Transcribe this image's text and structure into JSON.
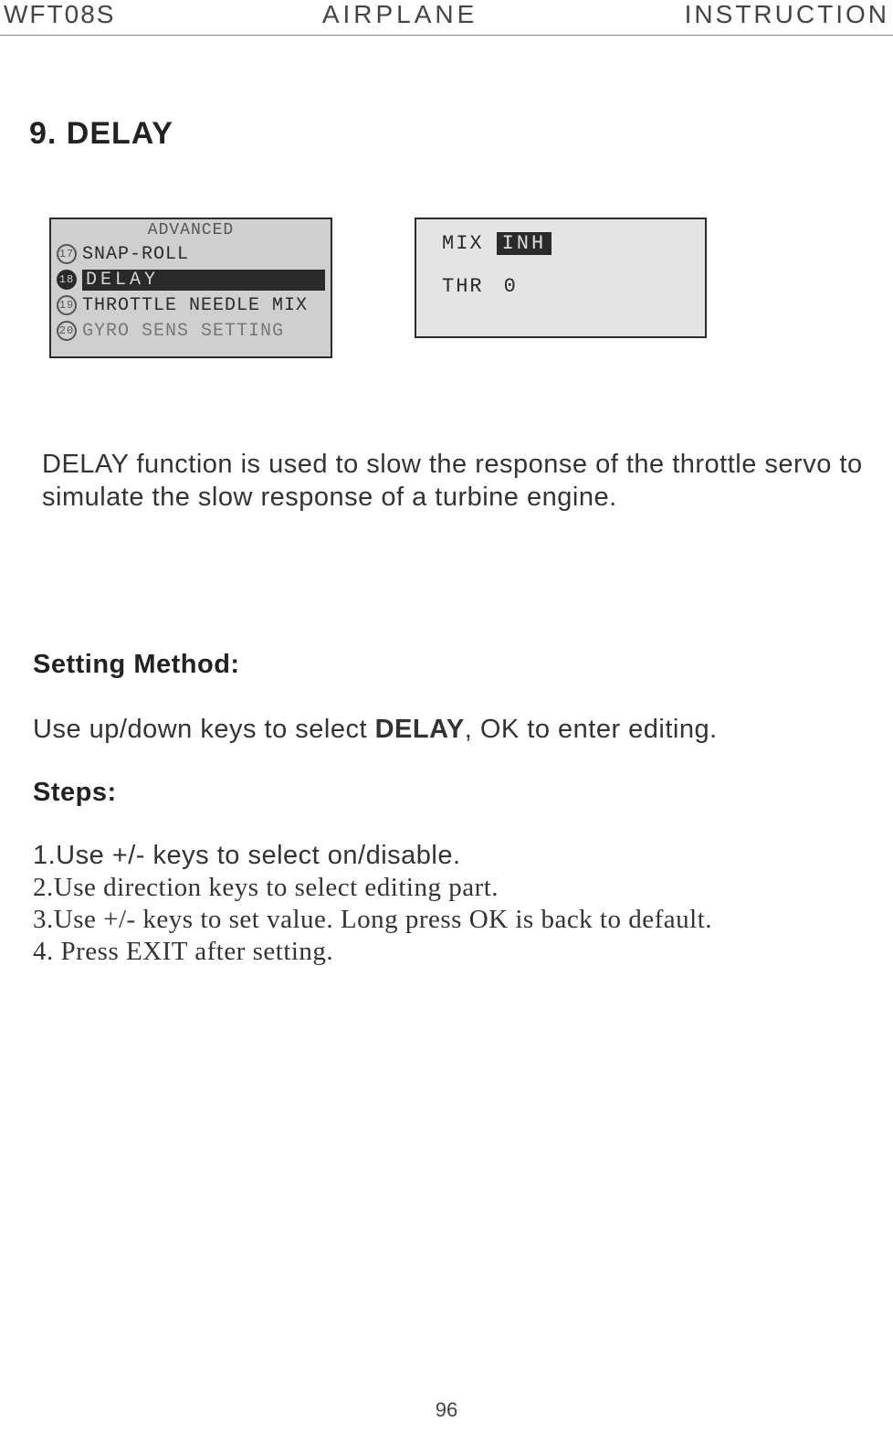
{
  "header": {
    "left": "WFT08S",
    "center": "AIRPLANE",
    "right": "INSTRUCTION"
  },
  "section_title": "9. DELAY",
  "lcd1": {
    "title": "ADVANCED",
    "items": [
      {
        "num": "17",
        "label": "SNAP-ROLL",
        "selected": false
      },
      {
        "num": "18",
        "label": "DELAY",
        "selected": true
      },
      {
        "num": "19",
        "label": "THROTTLE NEEDLE MIX",
        "selected": false
      },
      {
        "num": "20",
        "label": "GYRO SENS SETTING",
        "selected": false
      }
    ]
  },
  "lcd2": {
    "mix_label": "MIX",
    "mix_value": "INH",
    "thr_label": "THR",
    "thr_value": "0"
  },
  "paragraph": "DELAY function is used to slow the response of the throttle servo to simulate the slow response of a turbine engine.",
  "setting_method_label": "Setting Method:",
  "setting_method_text_pre": "Use up/down keys to select ",
  "setting_method_bold": "DELAY",
  "setting_method_text_post": ", OK to enter editing.",
  "steps_label": "Steps:",
  "steps": [
    "1.Use +/- keys  to select on/disable.",
    "2.Use direction keys to select editing part.",
    "3.Use +/- keys to set value. Long press OK is back to default.",
    "4. Press EXIT after setting."
  ],
  "page_number": "96"
}
